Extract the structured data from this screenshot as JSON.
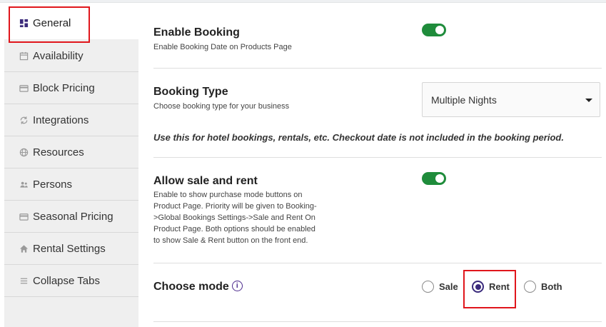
{
  "sidebar": {
    "items": [
      {
        "label": "General",
        "icon": "dashboard-icon"
      },
      {
        "label": "Availability",
        "icon": "calendar-icon"
      },
      {
        "label": "Block Pricing",
        "icon": "card-icon"
      },
      {
        "label": "Integrations",
        "icon": "sync-icon"
      },
      {
        "label": "Resources",
        "icon": "globe-icon"
      },
      {
        "label": "Persons",
        "icon": "people-icon"
      },
      {
        "label": "Seasonal Pricing",
        "icon": "card-icon"
      },
      {
        "label": "Rental Settings",
        "icon": "home-icon"
      },
      {
        "label": "Collapse Tabs",
        "icon": "menu-icon"
      }
    ],
    "active_index": 0
  },
  "settings": {
    "enable_booking": {
      "title": "Enable Booking",
      "desc": "Enable Booking Date on Products Page",
      "enabled": true
    },
    "booking_type": {
      "title": "Booking Type",
      "desc": "Choose booking type for your business",
      "value": "Multiple Nights",
      "note": "Use this for hotel bookings, rentals, etc. Checkout date is not included in the booking period."
    },
    "allow_sale_rent": {
      "title": "Allow sale and rent",
      "desc_lines": [
        "Enable to show purchase mode buttons on",
        "Product Page. Priority will be given to Booking-",
        ">Global Bookings Settings->Sale and Rent On",
        "Product Page. Both options should be enabled",
        "to show Sale & Rent button on the front end."
      ],
      "enabled": true
    },
    "choose_mode": {
      "title": "Choose mode",
      "info_glyph": "i",
      "options": [
        "Sale",
        "Rent",
        "Both"
      ],
      "selected": "Rent"
    }
  },
  "colors": {
    "toggle_on": "#1f8c3b",
    "radio_selected": "#3a2a7c",
    "highlight": "#e0161c",
    "sidebar_bg": "#efefef"
  }
}
